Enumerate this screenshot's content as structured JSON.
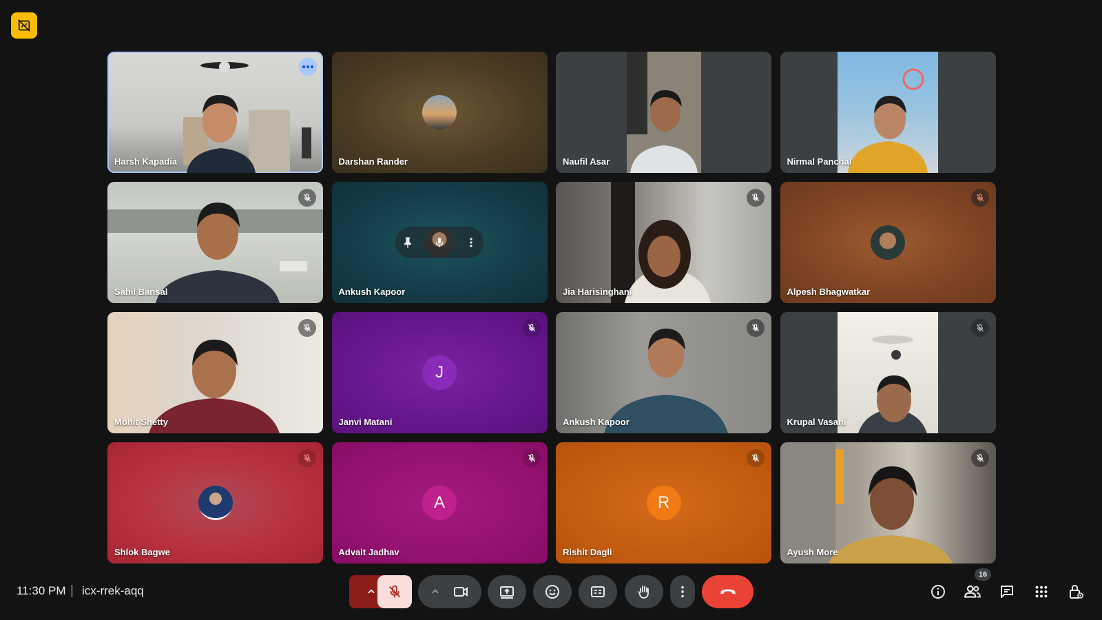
{
  "meeting": {
    "time": "11:30 PM",
    "code": "icx-rrek-aqq",
    "participant_count": "16"
  },
  "participants": [
    {
      "name": "Harsh Kapadia"
    },
    {
      "name": "Darshan Rander"
    },
    {
      "name": "Naufil Asar"
    },
    {
      "name": "Nirmal Panchal"
    },
    {
      "name": "Sahil Bansal"
    },
    {
      "name": "Ankush Kapoor"
    },
    {
      "name": "Jia Harisinghani"
    },
    {
      "name": "Alpesh Bhagwatkar"
    },
    {
      "name": "Mohit Shetty"
    },
    {
      "name": "Janvi Matani",
      "initial": "J"
    },
    {
      "name": "Ankush Kapoor"
    },
    {
      "name": "Krupal Vasani"
    },
    {
      "name": "Shlok Bagwe"
    },
    {
      "name": "Advait Jadhav",
      "initial": "A"
    },
    {
      "name": "Rishit Dagli",
      "initial": "R"
    },
    {
      "name": "Ayush More"
    }
  ],
  "colors": {
    "end_call": "#ea4335",
    "mic_off_bg": "#f9dedc",
    "mic_off_accent": "#b3261e",
    "active_outline": "#a8c7fa",
    "badge": "#fbbc04"
  },
  "icons": {
    "corner": "no-video-tile-icon",
    "controls": [
      "chevron-up-icon",
      "mic-off-icon",
      "chevron-up-icon",
      "camera-icon",
      "present-icon",
      "emoji-icon",
      "captions-icon",
      "raise-hand-icon",
      "more-vert-icon",
      "end-call-icon"
    ],
    "right": [
      "info-icon",
      "people-icon",
      "chat-icon",
      "apps-icon",
      "host-controls-icon"
    ]
  }
}
